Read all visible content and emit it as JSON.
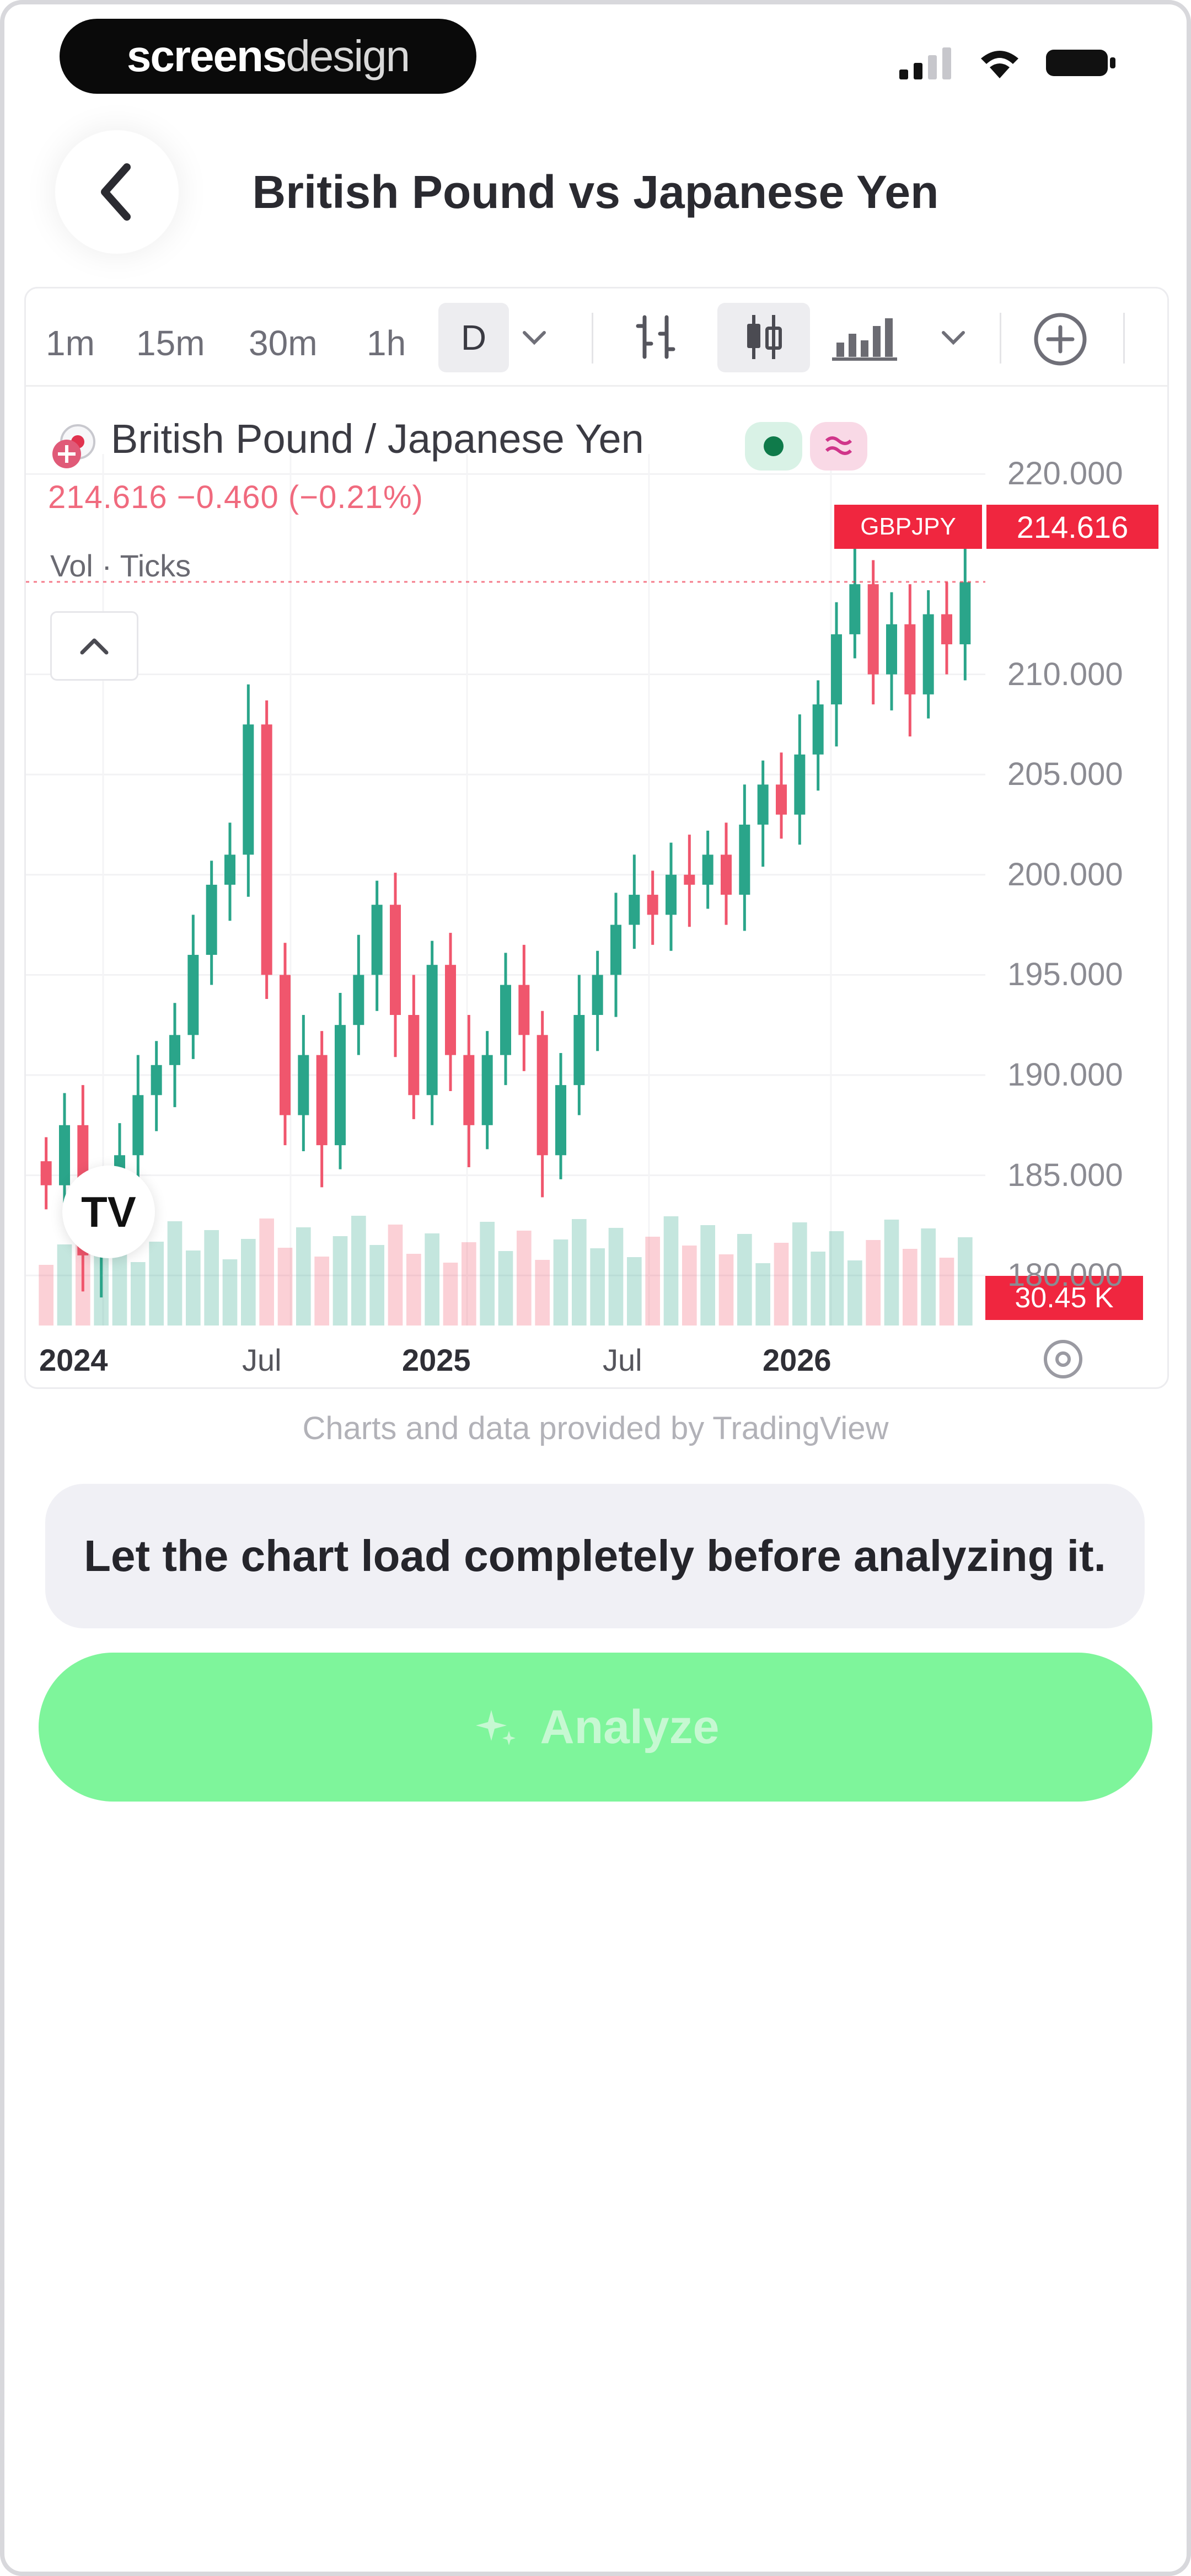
{
  "status_bar": {
    "brand_bold": "screens",
    "brand_light": "design",
    "icons": [
      "cellular-signal-icon",
      "wifi-icon",
      "battery-icon"
    ]
  },
  "header": {
    "title": "British Pound vs Japanese Yen",
    "back_icon": "chevron-left-icon"
  },
  "toolbar": {
    "timeframes": [
      "1m",
      "15m",
      "30m",
      "1h"
    ],
    "active_timeframe": "D",
    "icons": [
      "chevron-down-icon",
      "indicators-icon",
      "candlestick-icon",
      "bars-chart-icon",
      "chevron-down-icon",
      "add-circle-icon"
    ]
  },
  "chart_legend": {
    "title": "British Pound / Japanese Yen",
    "price_line": "214.616 −0.460 (−0.21%)",
    "volume_label": "Vol · Ticks"
  },
  "chart_data": {
    "type": "candlestick",
    "symbol": "GBPJPY",
    "last_price": "214.616",
    "last_volume": "30.45 K",
    "y_ticks": [
      "220.000",
      "210.000",
      "205.000",
      "200.000",
      "195.000",
      "190.000",
      "185.000",
      "180.000"
    ],
    "x_ticks": [
      "2024",
      "Jul",
      "2025",
      "Jul",
      "2026"
    ],
    "ylim": [
      177.5,
      221
    ],
    "series": [
      {
        "name": "GBPJPY",
        "values": [
          184.5,
          187.5,
          181.0,
          182.5,
          186.0,
          189.0,
          190.5,
          192.0,
          196.0,
          199.5,
          201.0,
          207.5,
          195.0,
          188.0,
          191.0,
          186.5,
          192.5,
          195.0,
          198.5,
          193.0,
          189.0,
          195.5,
          191.0,
          187.5,
          191.0,
          194.5,
          192.0,
          186.0,
          189.5,
          193.0,
          195.0,
          197.5,
          199.0,
          198.0,
          200.0,
          199.5,
          201.0,
          199.0,
          202.5,
          204.5,
          203.0,
          206.0,
          208.5,
          212.0,
          214.5,
          210.0,
          212.5,
          209.0,
          213.0,
          211.5,
          214.6
        ]
      }
    ],
    "grid": true
  },
  "chart_footer": {
    "settings_icon": "gear-icon",
    "logo_icon": "tradingview-logo-icon"
  },
  "attribution": "Charts and data provided by TradingView",
  "notice": "Let the chart load completely before analyzing it.",
  "analyze_button": {
    "label": "Analyze",
    "icon": "sparkle-icon"
  },
  "colors": {
    "accent_green": "#7ef59b",
    "up_candle": "#2aa58a",
    "down_candle": "#f0566d",
    "price_tag": "#f0263f"
  }
}
